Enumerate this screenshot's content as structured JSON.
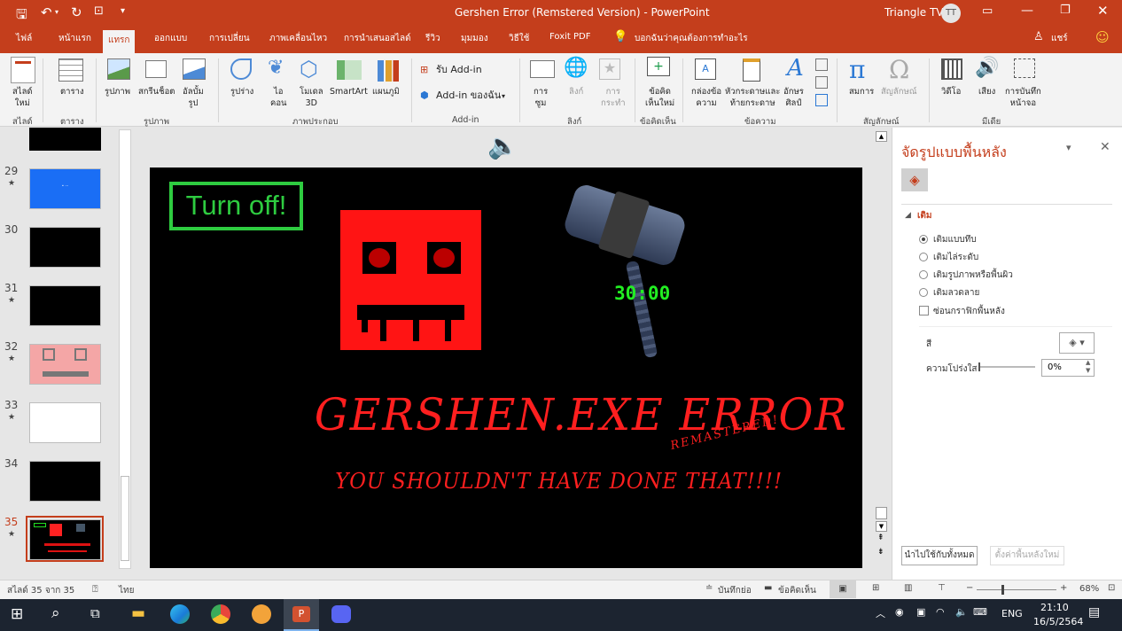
{
  "window": {
    "title": "Gershen Error (Remstered Version)  -  PowerPoint",
    "user": "Triangle TV",
    "user_initials": "TT"
  },
  "tabs": [
    "ไฟล์",
    "หน้าแรก",
    "แทรก",
    "ออกแบบ",
    "การเปลี่ยน",
    "ภาพเคลื่อนไหว",
    "การนำเสนอสไลด์",
    "รีวิว",
    "มุมมอง",
    "วิธีใช้",
    "Foxit PDF"
  ],
  "active_tab": "แทรก",
  "tell_me": "บอกฉันว่าคุณต้องการทำอะไร",
  "share": "แชร์",
  "ribbon": {
    "groups": [
      "สไลด์",
      "ตาราง",
      "รูปภาพ",
      "ภาพประกอบ",
      "Add-in",
      "ลิงก์",
      "ข้อคิดเห็น",
      "ข้อความ",
      "สัญลักษณ์",
      "มีเดีย"
    ],
    "new_slide": [
      "สไลด์",
      "ใหม่"
    ],
    "table": "ตาราง",
    "pictures": "รูปภาพ",
    "screenshot": "สกรีนช็อต",
    "album": [
      "อัลบั้ม",
      "รูป"
    ],
    "shapes": "รูปร่าง",
    "icons": [
      "ไอ",
      "คอน"
    ],
    "models": [
      "โมเดล",
      "3D"
    ],
    "smartart": "SmartArt",
    "chart": "แผนภูมิ",
    "get_addins": "รับ  Add-in",
    "my_addins": "Add-in ของฉัน",
    "zoom": [
      "การ",
      "ซูม"
    ],
    "link": "ลิงก์",
    "action": [
      "การ",
      "กระทำ"
    ],
    "new_comment": [
      "ข้อคิด",
      "เห็นใหม่"
    ],
    "textbox": [
      "กล่องข้อ",
      "ความ"
    ],
    "header_footer": [
      "หัวกระดาษและ",
      "ท้ายกระดาษ"
    ],
    "wordart": [
      "อักษร",
      "ศิลป์"
    ],
    "equation": "สมการ",
    "symbol": "สัญลักษณ์",
    "video": "วิดีโอ",
    "audio": "เสียง",
    "screen_recording": [
      "การบันทึก",
      "หน้าจอ"
    ]
  },
  "thumbnails": [
    {
      "num": "29",
      "star": "★",
      "bg": "#1a6ef5"
    },
    {
      "num": "30",
      "star": "",
      "bg": "#000000"
    },
    {
      "num": "31",
      "star": "★",
      "bg": "#000000"
    },
    {
      "num": "32",
      "star": "★",
      "bg": "#f4a6a6"
    },
    {
      "num": "33",
      "star": "★",
      "bg": "#ffffff"
    },
    {
      "num": "34",
      "star": "",
      "bg": "#000000"
    },
    {
      "num": "35",
      "star": "★",
      "bg": "#000000"
    }
  ],
  "slide": {
    "turn_off": "Turn off!",
    "timer": "30:00",
    "title": "GERSHEN.EXE ERROR",
    "remastered": "REMASTERED!",
    "subtitle": "YOU SHOULDN'T HAVE DONE THAT!!!!"
  },
  "format_pane": {
    "title": "จัดรูปแบบพื้นหลัง",
    "section": "เติม",
    "options": [
      "เติมแบบทึบ",
      "เติมไล่ระดับ",
      "เติมรูปภาพหรือพื้นผิว",
      "เติมลวดลาย"
    ],
    "selected": "เติมแบบทึบ",
    "hide_graphics": "ซ่อนกราฟิกพื้นหลัง",
    "color_label": "สี",
    "transparency_label": "ความโปร่งใส",
    "transparency_value": "0%",
    "apply_all": "นำไปใช้กับทั้งหมด",
    "reset": "ตั้งค่าพื้นหลังใหม่"
  },
  "status": {
    "slide_of": "สไลด์ 35 จาก 35",
    "language": "ไทย",
    "notes": "บันทึกย่อ",
    "comments": "ข้อคิดเห็น",
    "zoom": "68%",
    "zoom_level": 0.68
  },
  "taskbar": {
    "lang": "ENG",
    "time": "21:10",
    "date": "16/5/2564"
  },
  "colors": {
    "accent": "#c43e1c",
    "slide_red": "#ff1f1f",
    "timer_green": "#22ee22"
  }
}
